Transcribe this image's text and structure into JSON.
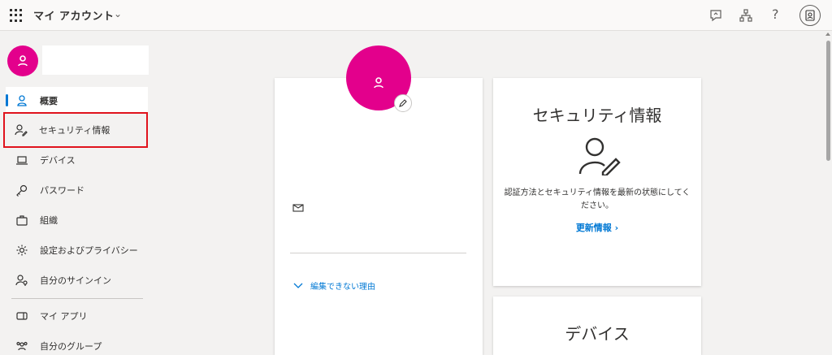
{
  "header": {
    "app_title": "マイ アカウント",
    "icons": [
      "feedback-icon",
      "org-chart-icon",
      "help-icon",
      "account-badge-icon"
    ],
    "help_symbol": "?"
  },
  "sidebar": {
    "items": [
      {
        "label": "概要",
        "icon": "person-icon",
        "active": true
      },
      {
        "label": "セキュリティ情報",
        "icon": "person-pen-icon",
        "highlighted": true
      },
      {
        "label": "デバイス",
        "icon": "laptop-icon"
      },
      {
        "label": "パスワード",
        "icon": "key-icon"
      },
      {
        "label": "組織",
        "icon": "briefcase-icon"
      },
      {
        "label": "設定およびプライバシー",
        "icon": "gear-icon"
      },
      {
        "label": "自分のサインイン",
        "icon": "person-key-icon"
      },
      {
        "label": "マイ アプリ",
        "icon": "apps-icon"
      },
      {
        "label": "自分のグループ",
        "icon": "group-icon"
      }
    ]
  },
  "profile_card": {
    "why_cant_edit": "編集できない理由"
  },
  "security_card": {
    "title": "セキュリティ情報",
    "description": "認証方法とセキュリティ情報を最新の状態にしてください。",
    "link": "更新情報 ›"
  },
  "devices_card": {
    "title": "デバイス"
  },
  "colors": {
    "accent": "#0078d4",
    "avatar": "#e3008c",
    "highlight": "#e0131d"
  }
}
